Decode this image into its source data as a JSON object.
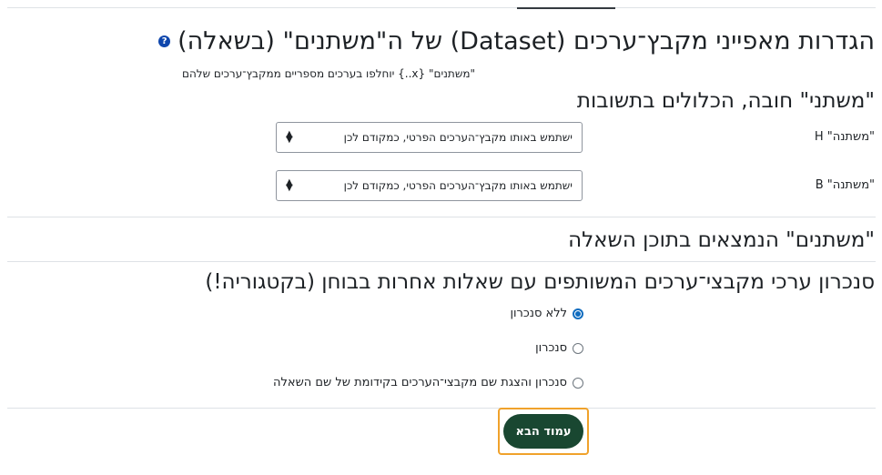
{
  "title": "הגדרות מאפייני מקבץ־ערכים (Dataset) של ה\"משתנים\" (בשאלה)",
  "description": "\"משתנים\" {x..} יוחלפו בערכים מספריים ממקבץ־ערכים שלהם",
  "required_section": {
    "heading": "\"משתני\" חובה, הכלולים בתשובות",
    "rows": [
      {
        "label": "\"משתנה\" H",
        "select_value": "ישתמש באותו מקבץ־הערכים הפרטי, כמקודם לכן"
      },
      {
        "label": "\"משתנה\" B",
        "select_value": "ישתמש באותו מקבץ־הערכים הפרטי, כמקודם לכן"
      }
    ]
  },
  "content_section": {
    "heading": "\"משתנים\" הנמצאים בתוכן השאלה"
  },
  "sync_section": {
    "heading": "סנכרון ערכי מקבצי־ערכים המשותפים עם שאלות אחרות בבוחן (בקטגוריה!)",
    "options": [
      {
        "label": "ללא סנכרון",
        "checked": true
      },
      {
        "label": "סנכרון",
        "checked": false
      },
      {
        "label": "סנכרון והצגת שם מקבצי־הערכים בקידומת של שם השאלה",
        "checked": false
      }
    ]
  },
  "next_button": "עמוד הבא",
  "icons": {
    "help": "help-icon",
    "select_arrows": "sort-arrows-icon"
  },
  "colors": {
    "button": "#194731",
    "focus_ring": "#f0a22b",
    "radio_checked": "#0f6cbf",
    "help_icon": "#0f47ad"
  }
}
